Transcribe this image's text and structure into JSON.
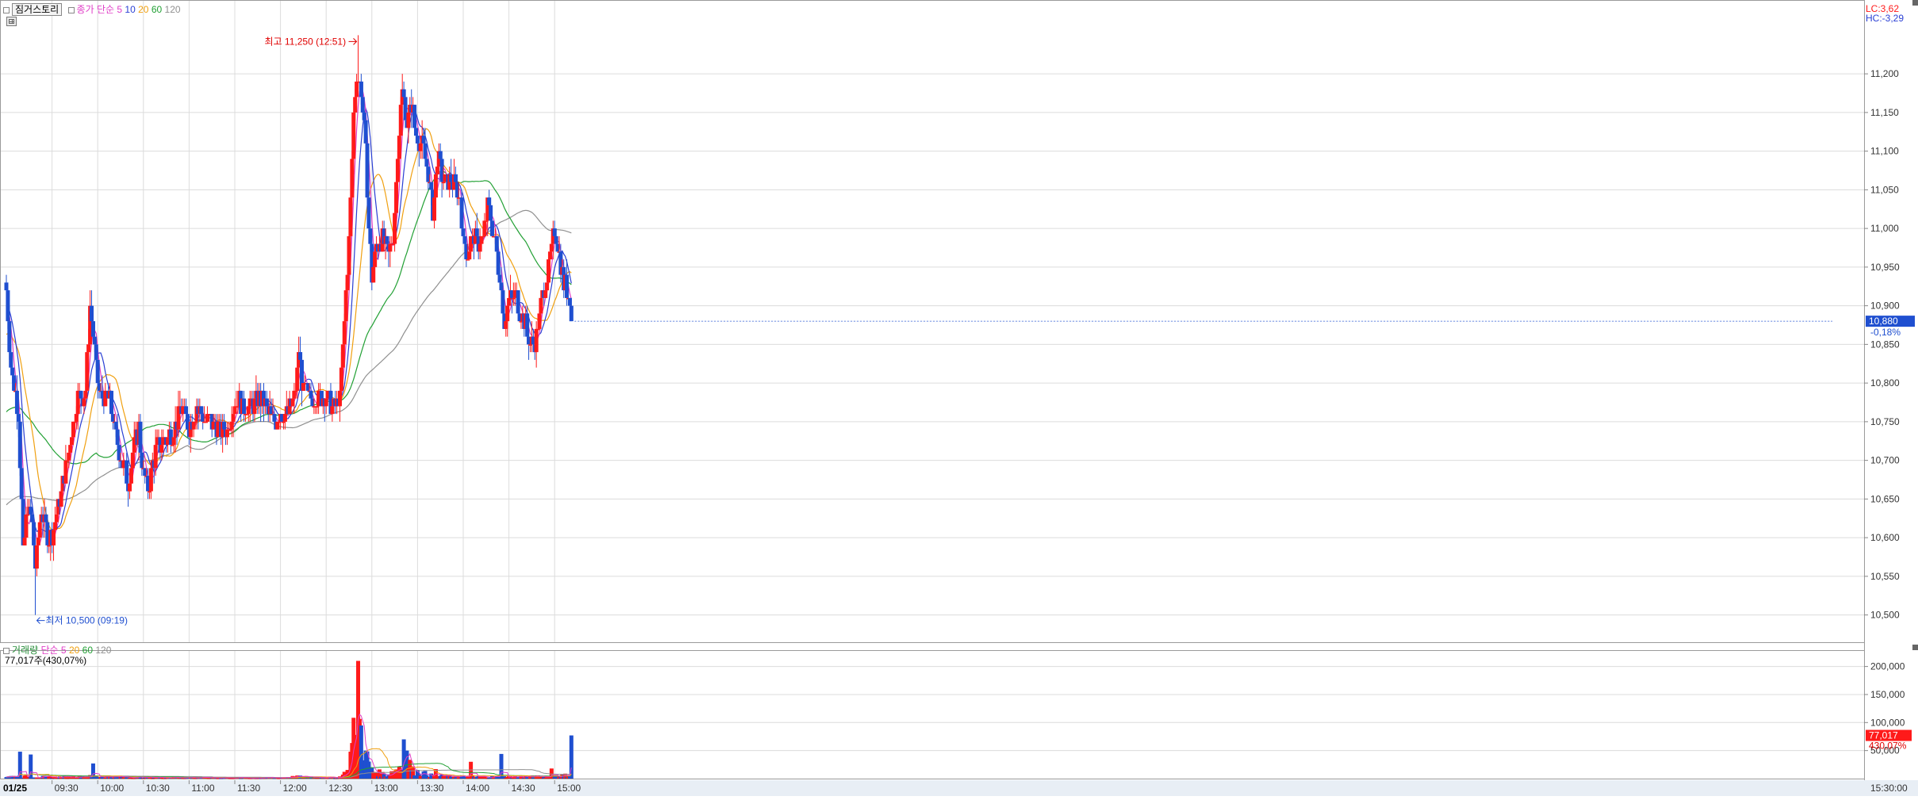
{
  "header": {
    "chart_button_label": "짐거스토리",
    "price_ma_label": "종가 단순",
    "vol_ma_label_1": "거래량",
    "vol_ma_label_2": "단순",
    "ma_periods": [
      "5",
      "10",
      "20",
      "60",
      "120"
    ],
    "volume_readout": "77,017주(430,07%)",
    "lc_label": "LC:3,62",
    "hc_label": "HC:-3,29"
  },
  "colors": {
    "up": "#ff1a1a",
    "down": "#1f4fd0",
    "ma5": "#e040c8",
    "ma10": "#2a3fd4",
    "ma20": "#f0a010",
    "ma60": "#22a034",
    "ma120": "#909090",
    "grid": "#dcdcdc",
    "current_price_bg": "#1f4fd0",
    "current_volume_bg": "#ff1a1a"
  },
  "price_panel": {
    "ylim": [
      10475,
      11275
    ],
    "yticks": [
      "11,200",
      "11,150",
      "11,100",
      "11,050",
      "11,000",
      "10,950",
      "10,900",
      "10,850",
      "10,800",
      "10,750",
      "10,700",
      "10,650",
      "10,600",
      "10,550",
      "10,500"
    ],
    "current_price": "10,880",
    "current_change": "-0,18%",
    "high_annotation": "최고 11,250 (12:51)",
    "low_annotation": "최저 10,500 (09:19)"
  },
  "volume_panel": {
    "ylim": [
      0,
      215000
    ],
    "yticks": [
      "200,000",
      "150,000",
      "100,000",
      "50,000"
    ],
    "current_volume": "77,017",
    "current_ratio": "430,07%"
  },
  "x_axis": {
    "date_label": "01/25",
    "time_labels": [
      "09:30",
      "10:00",
      "10:30",
      "11:00",
      "11:30",
      "12:00",
      "12:30",
      "13:00",
      "13:30",
      "14:00",
      "14:30",
      "15:00"
    ],
    "end_label": "15:30:00"
  },
  "chart_data": {
    "type": "candlestick",
    "session": "01/25 09:00 - 15:30",
    "interval_minutes": 1,
    "price_anchors": [
      [
        "09:00",
        10920
      ],
      [
        "09:03",
        10820
      ],
      [
        "09:05",
        10800
      ],
      [
        "09:08",
        10760
      ],
      [
        "09:11",
        10580
      ],
      [
        "09:14",
        10640
      ],
      [
        "09:17",
        10620
      ],
      [
        "09:19",
        10560
      ],
      [
        "09:23",
        10640
      ],
      [
        "09:27",
        10600
      ],
      [
        "09:31",
        10610
      ],
      [
        "09:35",
        10650
      ],
      [
        "09:39",
        10690
      ],
      [
        "09:43",
        10740
      ],
      [
        "09:47",
        10780
      ],
      [
        "09:52",
        10790
      ],
      [
        "09:55",
        10900
      ],
      [
        "09:57",
        10860
      ],
      [
        "10:00",
        10800
      ],
      [
        "10:03",
        10780
      ],
      [
        "10:08",
        10780
      ],
      [
        "10:12",
        10730
      ],
      [
        "10:16",
        10700
      ],
      [
        "10:20",
        10670
      ],
      [
        "10:24",
        10720
      ],
      [
        "10:27",
        10740
      ],
      [
        "10:30",
        10680
      ],
      [
        "10:33",
        10660
      ],
      [
        "10:36",
        10700
      ],
      [
        "10:40",
        10720
      ],
      [
        "10:45",
        10730
      ],
      [
        "10:50",
        10740
      ],
      [
        "10:55",
        10770
      ],
      [
        "11:00",
        10740
      ],
      [
        "11:05",
        10770
      ],
      [
        "11:10",
        10750
      ],
      [
        "11:15",
        10750
      ],
      [
        "11:20",
        10740
      ],
      [
        "11:25",
        10740
      ],
      [
        "11:30",
        10780
      ],
      [
        "11:35",
        10770
      ],
      [
        "11:40",
        10770
      ],
      [
        "11:45",
        10780
      ],
      [
        "11:50",
        10770
      ],
      [
        "11:55",
        10750
      ],
      [
        "12:00",
        10760
      ],
      [
        "12:05",
        10760
      ],
      [
        "12:10",
        10790
      ],
      [
        "12:12",
        10840
      ],
      [
        "12:15",
        10790
      ],
      [
        "12:20",
        10780
      ],
      [
        "12:25",
        10780
      ],
      [
        "12:30",
        10780
      ],
      [
        "12:35",
        10770
      ],
      [
        "12:39",
        10780
      ],
      [
        "12:42",
        10880
      ],
      [
        "12:45",
        10980
      ],
      [
        "12:48",
        11150
      ],
      [
        "12:50",
        11200
      ],
      [
        "12:53",
        11180
      ],
      [
        "12:56",
        11100
      ],
      [
        "12:58",
        11000
      ],
      [
        "13:00",
        10940
      ],
      [
        "13:03",
        10980
      ],
      [
        "13:07",
        10990
      ],
      [
        "13:11",
        10960
      ],
      [
        "13:14",
        10990
      ],
      [
        "13:17",
        11100
      ],
      [
        "13:20",
        11180
      ],
      [
        "13:23",
        11140
      ],
      [
        "13:26",
        11160
      ],
      [
        "13:29",
        11120
      ],
      [
        "13:32",
        11110
      ],
      [
        "13:35",
        11090
      ],
      [
        "13:37",
        11070
      ],
      [
        "13:40",
        11020
      ],
      [
        "13:43",
        11090
      ],
      [
        "13:46",
        11070
      ],
      [
        "13:49",
        11060
      ],
      [
        "13:52",
        11060
      ],
      [
        "13:55",
        11050
      ],
      [
        "13:58",
        11040
      ],
      [
        "14:00",
        10980
      ],
      [
        "14:03",
        10970
      ],
      [
        "14:07",
        10990
      ],
      [
        "14:10",
        10980
      ],
      [
        "14:13",
        10990
      ],
      [
        "14:16",
        11030
      ],
      [
        "14:20",
        10990
      ],
      [
        "14:24",
        10940
      ],
      [
        "14:27",
        10880
      ],
      [
        "14:30",
        10910
      ],
      [
        "14:35",
        10910
      ],
      [
        "14:40",
        10880
      ],
      [
        "14:44",
        10850
      ],
      [
        "14:48",
        10860
      ],
      [
        "14:51",
        10900
      ],
      [
        "14:54",
        10930
      ],
      [
        "14:58",
        10970
      ],
      [
        "15:00",
        11000
      ],
      [
        "15:03",
        10970
      ],
      [
        "15:06",
        10930
      ],
      [
        "15:08",
        10920
      ],
      [
        "15:10",
        10910
      ],
      [
        "15:11",
        10880
      ]
    ],
    "session_high": {
      "time": "12:51",
      "price": 11250
    },
    "session_low": {
      "time": "09:19",
      "price": 10500
    },
    "volume_anchors": [
      [
        "09:00",
        4000
      ],
      [
        "09:20",
        3500
      ],
      [
        "09:30",
        2500
      ],
      [
        "09:55",
        4000
      ],
      [
        "10:30",
        2200
      ],
      [
        "11:00",
        1800
      ],
      [
        "11:30",
        1500
      ],
      [
        "12:00",
        1500
      ],
      [
        "12:10",
        3500
      ],
      [
        "12:38",
        1800
      ],
      [
        "12:44",
        12000
      ],
      [
        "12:48",
        70000
      ],
      [
        "12:50",
        120000
      ],
      [
        "12:53",
        80000
      ],
      [
        "12:56",
        40000
      ],
      [
        "13:00",
        14000
      ],
      [
        "13:10",
        6000
      ],
      [
        "13:17",
        18000
      ],
      [
        "13:22",
        40000
      ],
      [
        "13:27",
        14000
      ],
      [
        "13:40",
        5000
      ],
      [
        "14:00",
        3500
      ],
      [
        "14:30",
        3000
      ],
      [
        "15:00",
        4000
      ],
      [
        "15:08",
        6000
      ],
      [
        "15:11",
        8000
      ]
    ],
    "volume_spikes": [
      [
        "09:09",
        48000
      ],
      [
        "09:16",
        43000
      ],
      [
        "09:57",
        27000
      ],
      [
        "12:51",
        210000
      ],
      [
        "12:49",
        78000
      ],
      [
        "13:21",
        70000
      ],
      [
        "13:23",
        50000
      ],
      [
        "13:42",
        17000
      ],
      [
        "14:05",
        30000
      ],
      [
        "14:25",
        44000
      ],
      [
        "14:58",
        18000
      ],
      [
        "15:11",
        77017
      ]
    ],
    "moving_averages": [
      "5",
      "10",
      "20",
      "60",
      "120"
    ],
    "xlabel": "",
    "ylabel": "",
    "grid": true
  }
}
